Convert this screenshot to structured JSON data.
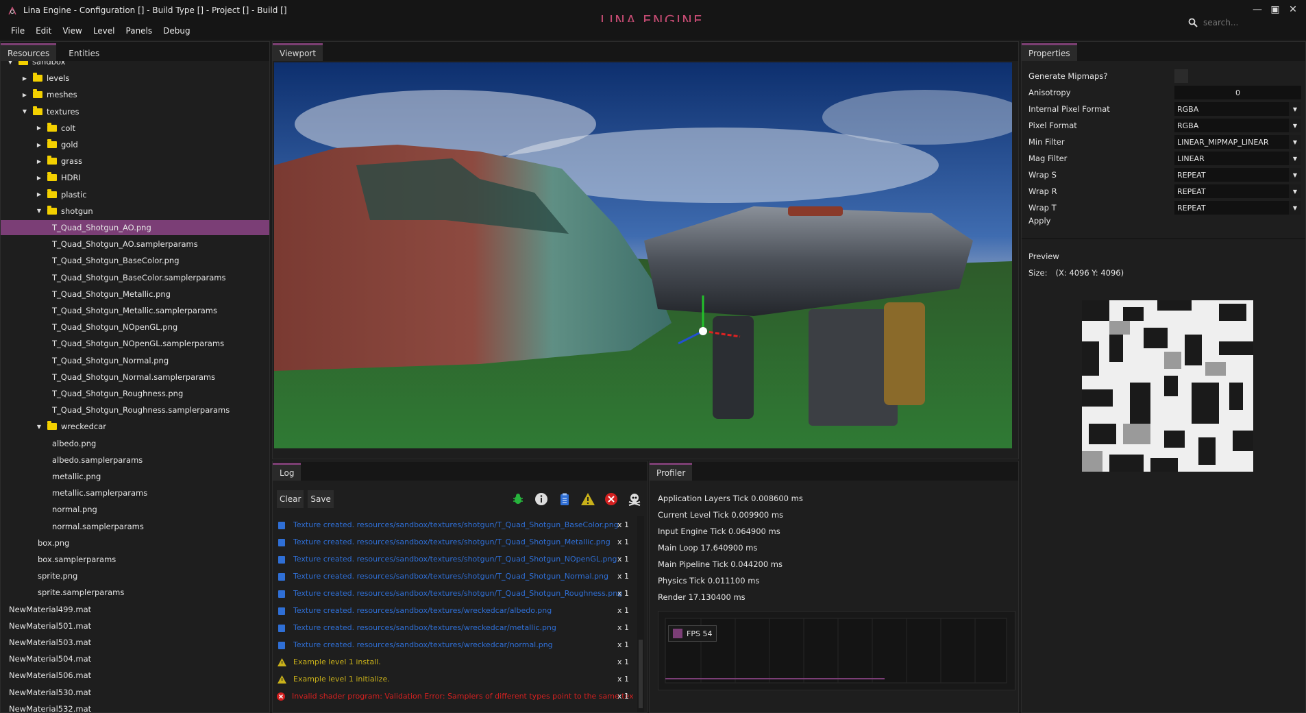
{
  "window": {
    "title": "Lina Engine - Configuration [] - Build Type [] - Project [] - Build []",
    "logo": "LINA ENGINE"
  },
  "menu": [
    "File",
    "Edit",
    "View",
    "Level",
    "Panels",
    "Debug"
  ],
  "search": {
    "placeholder": "search..."
  },
  "left_panel": {
    "tabs": [
      "Resources",
      "Entities"
    ],
    "tree": [
      {
        "label": "sandbox",
        "indent": 1,
        "folder": true,
        "expanded": true
      },
      {
        "label": "levels",
        "indent": 2,
        "folder": true,
        "expanded": false
      },
      {
        "label": "meshes",
        "indent": 2,
        "folder": true,
        "expanded": false
      },
      {
        "label": "textures",
        "indent": 2,
        "folder": true,
        "expanded": true
      },
      {
        "label": "colt",
        "indent": 3,
        "folder": true,
        "expanded": false
      },
      {
        "label": "gold",
        "indent": 3,
        "folder": true,
        "expanded": false
      },
      {
        "label": "grass",
        "indent": 3,
        "folder": true,
        "expanded": false
      },
      {
        "label": "HDRI",
        "indent": 3,
        "folder": true,
        "expanded": false
      },
      {
        "label": "plastic",
        "indent": 3,
        "folder": true,
        "expanded": false
      },
      {
        "label": "shotgun",
        "indent": 3,
        "folder": true,
        "expanded": true
      },
      {
        "label": "T_Quad_Shotgun_AO.png",
        "indent": 4,
        "selected": true
      },
      {
        "label": "T_Quad_Shotgun_AO.samplerparams",
        "indent": 4
      },
      {
        "label": "T_Quad_Shotgun_BaseColor.png",
        "indent": 4
      },
      {
        "label": "T_Quad_Shotgun_BaseColor.samplerparams",
        "indent": 4
      },
      {
        "label": "T_Quad_Shotgun_Metallic.png",
        "indent": 4
      },
      {
        "label": "T_Quad_Shotgun_Metallic.samplerparams",
        "indent": 4
      },
      {
        "label": "T_Quad_Shotgun_NOpenGL.png",
        "indent": 4
      },
      {
        "label": "T_Quad_Shotgun_NOpenGL.samplerparams",
        "indent": 4
      },
      {
        "label": "T_Quad_Shotgun_Normal.png",
        "indent": 4
      },
      {
        "label": "T_Quad_Shotgun_Normal.samplerparams",
        "indent": 4
      },
      {
        "label": "T_Quad_Shotgun_Roughness.png",
        "indent": 4
      },
      {
        "label": "T_Quad_Shotgun_Roughness.samplerparams",
        "indent": 4
      },
      {
        "label": "wreckedcar",
        "indent": 3,
        "folder": true,
        "expanded": true
      },
      {
        "label": "albedo.png",
        "indent": 4
      },
      {
        "label": "albedo.samplerparams",
        "indent": 4
      },
      {
        "label": "metallic.png",
        "indent": 4
      },
      {
        "label": "metallic.samplerparams",
        "indent": 4
      },
      {
        "label": "normal.png",
        "indent": 4
      },
      {
        "label": "normal.samplerparams",
        "indent": 4
      },
      {
        "label": "box.png",
        "indent": 3
      },
      {
        "label": "box.samplerparams",
        "indent": 3
      },
      {
        "label": "sprite.png",
        "indent": 3
      },
      {
        "label": "sprite.samplerparams",
        "indent": 3
      },
      {
        "label": "NewMaterial499.mat",
        "indent": 0
      },
      {
        "label": "NewMaterial501.mat",
        "indent": 0
      },
      {
        "label": "NewMaterial503.mat",
        "indent": 0
      },
      {
        "label": "NewMaterial504.mat",
        "indent": 0
      },
      {
        "label": "NewMaterial506.mat",
        "indent": 0
      },
      {
        "label": "NewMaterial530.mat",
        "indent": 0
      },
      {
        "label": "NewMaterial532.mat",
        "indent": 0
      }
    ]
  },
  "viewport": {
    "tab": "Viewport"
  },
  "log": {
    "tab": "Log",
    "clear_label": "Clear",
    "save_label": "Save",
    "filter_icons": [
      "bug-icon",
      "info-icon",
      "clipboard-icon",
      "warning-icon",
      "error-icon",
      "skull-icon"
    ],
    "entries": [
      {
        "type": "info",
        "text": "Texture created. resources/sandbox/textures/shotgun/T_Quad_Shotgun_BaseColor.png",
        "count": "x 1"
      },
      {
        "type": "info",
        "text": "Texture created. resources/sandbox/textures/shotgun/T_Quad_Shotgun_Metallic.png",
        "count": "x 1"
      },
      {
        "type": "info",
        "text": "Texture created. resources/sandbox/textures/shotgun/T_Quad_Shotgun_NOpenGL.png",
        "count": "x 1"
      },
      {
        "type": "info",
        "text": "Texture created. resources/sandbox/textures/shotgun/T_Quad_Shotgun_Normal.png",
        "count": "x 1"
      },
      {
        "type": "info",
        "text": "Texture created. resources/sandbox/textures/shotgun/T_Quad_Shotgun_Roughness.png",
        "count": "x 1"
      },
      {
        "type": "info",
        "text": "Texture created. resources/sandbox/textures/wreckedcar/albedo.png",
        "count": "x 1"
      },
      {
        "type": "info",
        "text": "Texture created. resources/sandbox/textures/wreckedcar/metallic.png",
        "count": "x 1"
      },
      {
        "type": "info",
        "text": "Texture created. resources/sandbox/textures/wreckedcar/normal.png",
        "count": "x 1"
      },
      {
        "type": "warning",
        "text": "Example level 1 install.",
        "count": "x 1"
      },
      {
        "type": "warning",
        "text": "Example level 1 initialize.",
        "count": "x 1"
      },
      {
        "type": "error",
        "text": "Invalid shader program: Validation Error: Samplers of different types point to the same texture",
        "count": "x 1"
      }
    ],
    "colors": {
      "info": "#2f6fd6",
      "warning": "#c9b11a",
      "error": "#d42020"
    }
  },
  "profiler": {
    "tab": "Profiler",
    "rows": [
      "Application Layers Tick 0.008600 ms",
      "Current Level Tick 0.009900 ms",
      "Input Engine Tick 0.064900 ms",
      "Main Loop 17.640900 ms",
      "Main Pipeline Tick 0.044200 ms",
      "Physics Tick 0.011100 ms",
      "Render 17.130400 ms"
    ],
    "fps_label": "FPS 54"
  },
  "properties": {
    "tab": "Properties",
    "generate_mipmaps": "Generate Mipmaps?",
    "fields": [
      {
        "label": "Anisotropy",
        "value": "0",
        "center": true
      },
      {
        "label": "Internal Pixel Format",
        "value": "RGBA",
        "dropdown": true
      },
      {
        "label": "Pixel Format",
        "value": "RGBA",
        "dropdown": true
      },
      {
        "label": "Min Filter",
        "value": "LINEAR_MIPMAP_LINEAR",
        "dropdown": true
      },
      {
        "label": "Mag Filter",
        "value": "LINEAR",
        "dropdown": true
      },
      {
        "label": "Wrap S",
        "value": "REPEAT",
        "dropdown": true
      },
      {
        "label": "Wrap R",
        "value": "REPEAT",
        "dropdown": true
      },
      {
        "label": "Wrap T",
        "value": "REPEAT",
        "dropdown": true
      }
    ],
    "apply_label": "Apply",
    "preview_label": "Preview",
    "size_label": "Size:",
    "size_value": "(X: 4096 Y: 4096)"
  },
  "accent_color": "#7b3e76"
}
